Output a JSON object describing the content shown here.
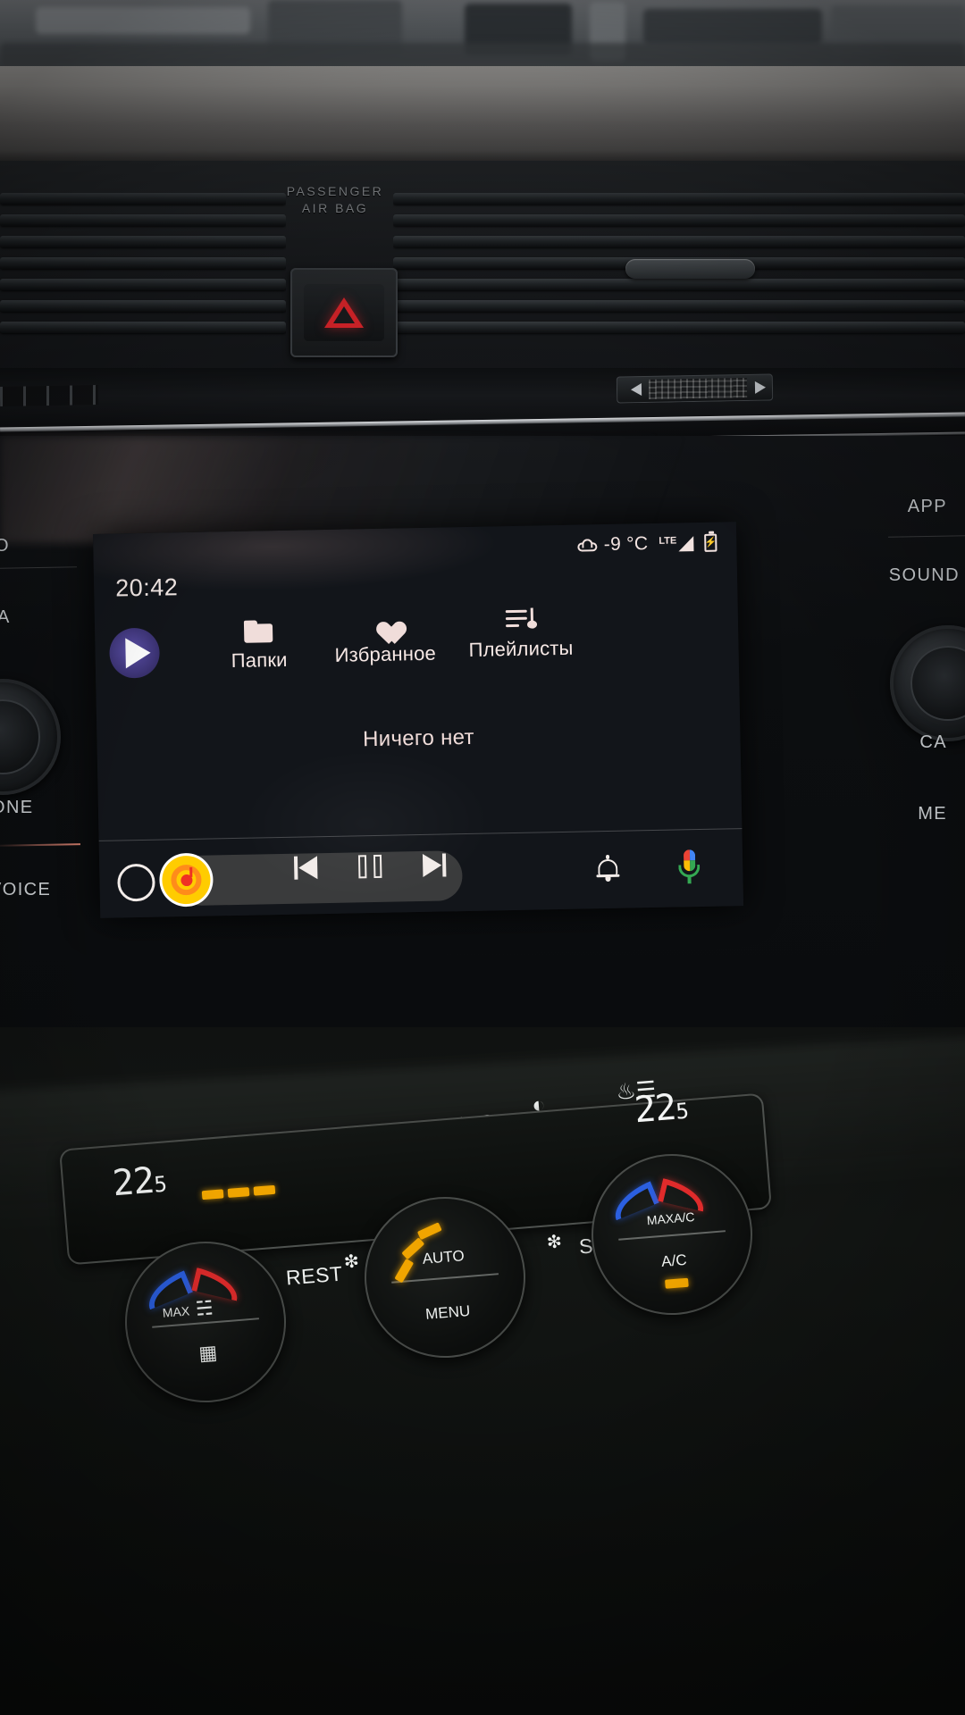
{
  "scene": {
    "description": "Car dashboard photo with Android Auto media screen and physical climate controls",
    "airbag_label_line1": "PASSENGER",
    "airbag_label_line2": "AIR BAG",
    "hazard_icon": "warning-triangle-icon"
  },
  "screen": {
    "clock": "20:42",
    "status": {
      "weather_icon": "cloud-icon",
      "temperature": "-9 °C",
      "network_label": "LTE",
      "signal_icon": "signal-bars-icon",
      "battery_icon": "battery-charging-icon"
    },
    "app_icon": "android-auto-media-app-icon",
    "tabs": [
      {
        "label": "Папки",
        "icon": "folder-icon"
      },
      {
        "label": "Избранное",
        "icon": "heart-icon"
      },
      {
        "label": "Плейлисты",
        "icon": "queue-music-icon"
      }
    ],
    "empty_message": "Ничего нет",
    "controls": {
      "home_icon": "home-circle-icon",
      "app_shortcut_icon": "yandex-music-icon",
      "previous_label": "previous-track-icon",
      "pause_label": "pause-icon",
      "next_label": "next-track-icon",
      "notifications_icon": "bell-icon",
      "assistant_icon": "google-assistant-mic-icon"
    },
    "accent_color": "#f0dcd9",
    "background_color": "#12151a"
  },
  "hard_keys": {
    "left": [
      "O",
      "IA",
      "ONE",
      "VOICE"
    ],
    "right": [
      "APP",
      "SOUND",
      "CA",
      "ME"
    ]
  },
  "climate": {
    "left_temperature": {
      "value": "22",
      "decimal": "5"
    },
    "right_temperature": {
      "value": "22",
      "decimal": "5"
    },
    "seat_heat_icon_left": "seat-heating-icon",
    "seat_heat_icon_right": "seat-heating-icon",
    "steering_heat_icon": "steering-wheel-heating-icon",
    "defrost_icon": "windshield-defrost-icon",
    "airflow_face_icon": "airflow-face-icon",
    "airflow_feet_icon": "airflow-feet-icon",
    "seat_heat_level_bars": 3,
    "left_dial": {
      "max_label": "MAX",
      "defrost_icon": "front-defrost-icon",
      "rear_defrost_icon": "rear-defrost-icon"
    },
    "center_dial": {
      "auto_label": "AUTO",
      "menu_label": "MENU",
      "rest_label": "REST",
      "sync_label": "SYNC",
      "fan_icon": "fan-icon",
      "fan_level": 3
    },
    "right_dial": {
      "max_ac_label": "MAXA/C",
      "ac_label": "A/C",
      "ac_on": true
    },
    "amber_color": "#f0a500",
    "cold_color": "#2b5fe0",
    "warm_color": "#e02b2b"
  }
}
